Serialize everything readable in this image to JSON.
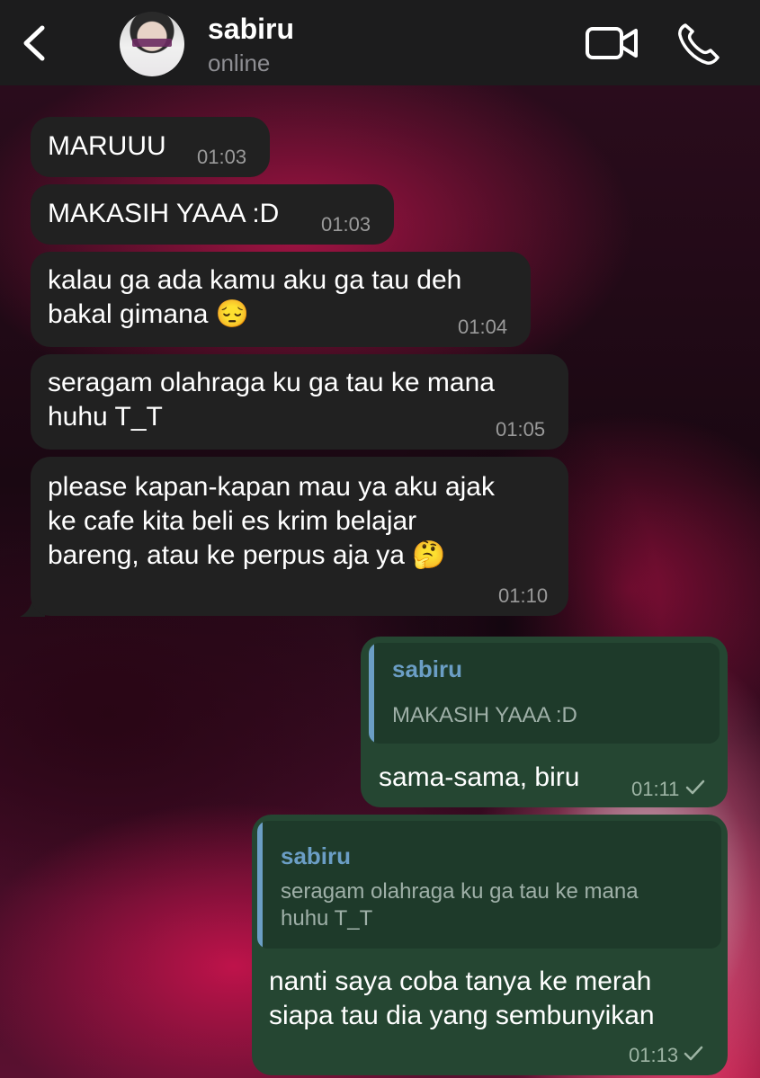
{
  "header": {
    "contact_name": "sabiru",
    "status": "online",
    "back_icon": "chevron-left-icon",
    "video_icon": "video-camera-icon",
    "call_icon": "phone-icon"
  },
  "colors": {
    "header_bg": "#1c1c1d",
    "incoming_bubble": "#212121",
    "outgoing_bubble": "#254632",
    "quote_accent": "#6b9ec5"
  },
  "messages": [
    {
      "direction": "in",
      "text": "MARUUU",
      "time": "01:03"
    },
    {
      "direction": "in",
      "text": "MAKASIH YAAA :D",
      "time": "01:03"
    },
    {
      "direction": "in",
      "text": "kalau ga ada kamu aku ga tau deh\nbakal gimana 😔",
      "time": "01:04"
    },
    {
      "direction": "in",
      "text": "seragam olahraga ku ga tau ke mana\nhuhu T_T",
      "time": "01:05"
    },
    {
      "direction": "in",
      "text": "please kapan-kapan mau ya aku ajak\nke cafe kita beli es krim belajar\nbareng, atau ke perpus aja ya 🤔",
      "time": "01:10"
    },
    {
      "direction": "out",
      "reply_to": {
        "name": "sabiru",
        "text": "MAKASIH YAAA :D"
      },
      "text": "sama-sama, biru",
      "time": "01:11",
      "status": "sent"
    },
    {
      "direction": "out",
      "reply_to": {
        "name": "sabiru",
        "text": "seragam olahraga ku ga tau ke mana\nhuhu T_T"
      },
      "text": "nanti saya coba tanya ke merah\nsiapa tau dia yang sembunyikan",
      "time": "01:13",
      "status": "sent"
    }
  ]
}
